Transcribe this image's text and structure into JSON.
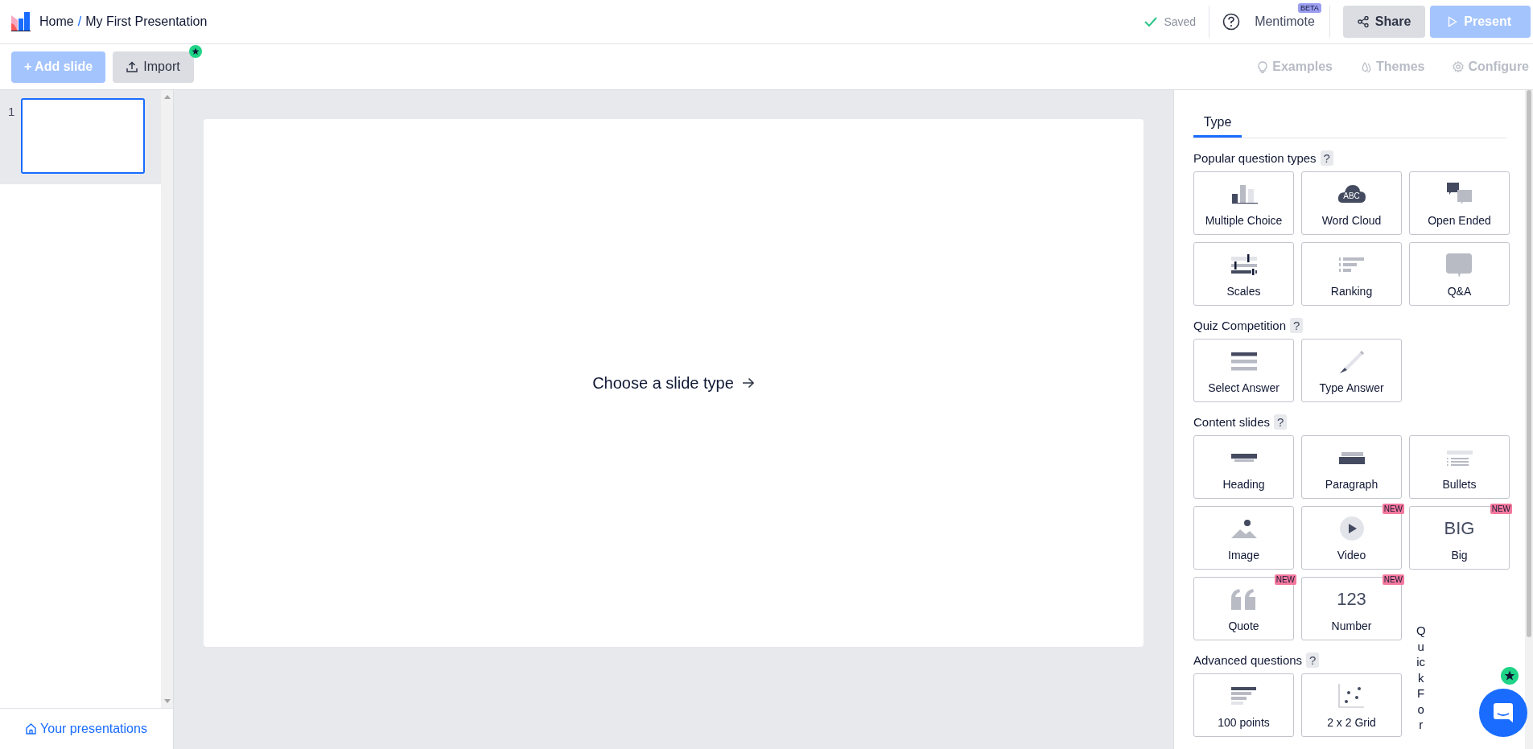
{
  "header": {
    "breadcrumb": [
      {
        "label": "Home"
      },
      {
        "label": "My First Presentation"
      }
    ],
    "separator": "/",
    "status": "Saved",
    "help_label": "Mentimote",
    "help_badge": "BETA",
    "buttons": [
      {
        "label": "Share",
        "kind": "share",
        "disabled": false
      },
      {
        "label": "Present",
        "kind": "present",
        "disabled": true
      }
    ]
  },
  "toolbar": {
    "add_slide": {
      "label": "+ Add slide",
      "disabled": true
    },
    "import": {
      "label": "Import",
      "starred": true
    },
    "links": [
      {
        "label": "Examples",
        "kind": "examples",
        "disabled": true
      },
      {
        "label": "Themes",
        "kind": "themes",
        "disabled": true
      },
      {
        "label": "Configure",
        "kind": "configure",
        "disabled": true
      }
    ]
  },
  "slides": [
    {
      "number": "1",
      "selected": true
    }
  ],
  "sidebar_footer": {
    "label": "Your presentations"
  },
  "canvas": {
    "prompt": "Choose a slide type"
  },
  "panel": {
    "tabs": [
      {
        "label": "Type",
        "selected": true
      }
    ],
    "sections": [
      {
        "title": "Popular question types",
        "help": "?",
        "tiles": [
          {
            "label": "Multiple Choice",
            "kind": "bars"
          },
          {
            "label": "Word Cloud",
            "kind": "cloud",
            "icon_text": "ABC"
          },
          {
            "label": "Open Ended",
            "kind": "bubbles"
          },
          {
            "label": "Scales",
            "kind": "scales"
          },
          {
            "label": "Ranking",
            "kind": "ranking"
          },
          {
            "label": "Q&A",
            "kind": "qa"
          }
        ]
      },
      {
        "title": "Quiz Competition",
        "help": "?",
        "tiles": [
          {
            "label": "Select Answer",
            "kind": "select"
          },
          {
            "label": "Type Answer",
            "kind": "pencil"
          }
        ]
      },
      {
        "title": "Content slides",
        "help": "?",
        "tiles": [
          {
            "label": "Heading",
            "kind": "heading"
          },
          {
            "label": "Paragraph",
            "kind": "paragraph"
          },
          {
            "label": "Bullets",
            "kind": "bullets"
          },
          {
            "label": "Image",
            "kind": "image"
          },
          {
            "label": "Video",
            "kind": "video",
            "badge": "NEW"
          },
          {
            "label": "Big",
            "kind": "glyph",
            "glyph": "BIG",
            "badge": "NEW"
          },
          {
            "label": "Quote",
            "kind": "quote",
            "badge": "NEW"
          },
          {
            "label": "Number",
            "kind": "glyph",
            "glyph": "123",
            "badge": "NEW"
          }
        ]
      },
      {
        "title": "Advanced questions",
        "help": "?",
        "tiles": [
          {
            "label": "100 points",
            "kind": "points"
          },
          {
            "label": "2 x 2 Grid",
            "kind": "grid"
          }
        ]
      }
    ],
    "side_label": "QuickFor"
  },
  "chat": {
    "starred": true
  }
}
